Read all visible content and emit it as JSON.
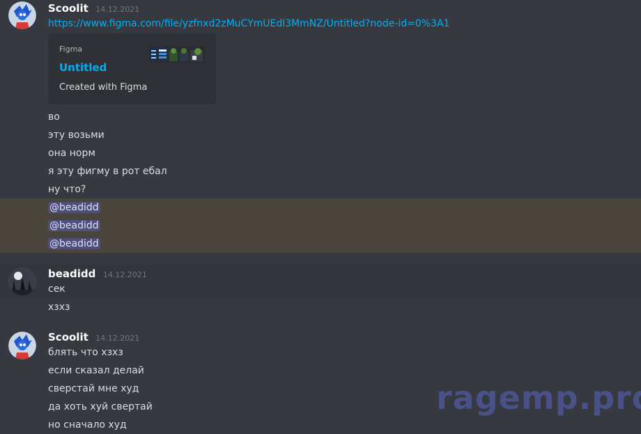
{
  "messages": [
    {
      "author": "Scoolit",
      "timestamp": "14.12.2021",
      "link": "https://www.figma.com/file/yzfnxd2zMuCYmUEdl3MmNZ/Untitled?node-id=0%3A1",
      "embed": {
        "provider": "Figma",
        "title": "Untitled",
        "description": "Created with Figma"
      },
      "lines": [
        "во",
        "эту возьми",
        "она норм",
        "я эту фигму в рот ебал",
        "ну что?"
      ],
      "mentions": [
        "@beadidd",
        "@beadidd",
        "@beadidd"
      ]
    },
    {
      "author": "beadidd",
      "timestamp": "14.12.2021",
      "lines": [
        "сек",
        "хзхз"
      ]
    },
    {
      "author": "Scoolit",
      "timestamp": "14.12.2021",
      "lines": [
        "блять что хзхз",
        "если сказал делай",
        "сверстай мне худ",
        "да хоть хуй свертай",
        "но сначало худ"
      ]
    }
  ],
  "watermark": "ragemp.pro",
  "colors": {
    "background": "#36393f",
    "mention_highlight": "#49443c",
    "link": "#00aff4",
    "embed_bg": "#2f3136"
  }
}
